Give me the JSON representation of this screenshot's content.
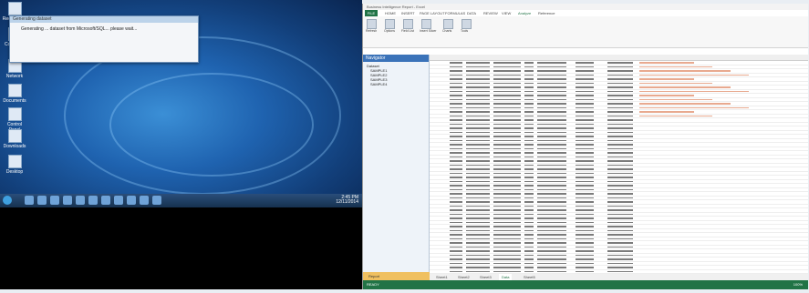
{
  "desktop": {
    "dialog": {
      "title": "Generating dataset",
      "message": "Generating ... dataset from Microsoft/SQL... please wait..."
    },
    "icons": [
      {
        "label": "Recycle Bin"
      },
      {
        "label": "Computer"
      },
      {
        "label": "Network"
      },
      {
        "label": "Documents"
      },
      {
        "label": "Control Panel"
      },
      {
        "label": "Downloads"
      },
      {
        "label": "Desktop"
      }
    ],
    "clock": {
      "time": "2:45 PM",
      "date": "12/11/2014"
    }
  },
  "excel": {
    "window_title": "Business Intelligence Report - Excel",
    "tabs": [
      "FILE",
      "HOME",
      "INSERT",
      "PAGE LAYOUT",
      "FORMULAS",
      "DATA",
      "REVIEW",
      "VIEW",
      "Analyze",
      "Reference"
    ],
    "ribbon_groups": [
      "Refresh",
      "Options",
      "Field List",
      "Insert Slicer",
      "Charts",
      "Tools"
    ],
    "nav": {
      "header": "Navigator",
      "items": [
        "Dataset",
        "SAMPLE1",
        "SAMPLE2",
        "SAMPLE3",
        "SAMPLE4"
      ],
      "footer": "Report"
    },
    "sheet_tabs": [
      "Sheet1",
      "Sheet2",
      "Sheet3",
      "Data",
      "Sheet5"
    ],
    "active_sheet": "Data",
    "status": "READY",
    "zoom": "100%"
  }
}
